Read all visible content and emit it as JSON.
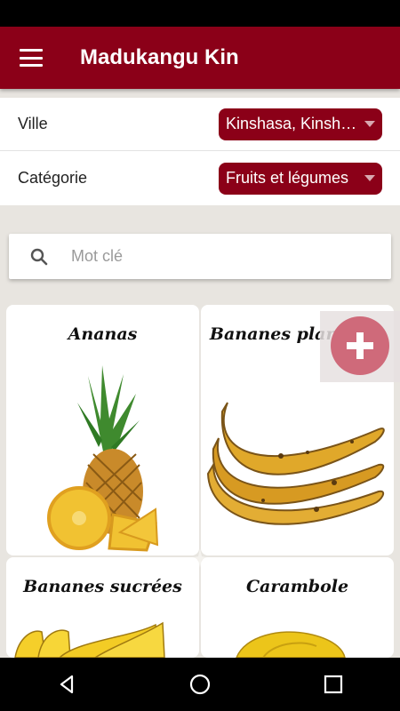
{
  "app": {
    "title": "Madukangu Kin"
  },
  "filters": {
    "city": {
      "label": "Ville",
      "value": "Kinshasa, Kinshasa"
    },
    "category": {
      "label": "Catégorie",
      "value": "Fruits et légumes"
    }
  },
  "search": {
    "placeholder": "Mot clé",
    "value": ""
  },
  "products": [
    {
      "name": "Ananas"
    },
    {
      "name": "Bananes plantains"
    },
    {
      "name": "Bananes sucrées"
    },
    {
      "name": "Carambole"
    }
  ],
  "colors": {
    "primary": "#8b0018",
    "fab": "#cf6a7a",
    "background": "#e8e5e0"
  },
  "icons": {
    "menu": "hamburger-icon",
    "search": "search-icon",
    "fab": "plus-icon",
    "nav": [
      "back-icon",
      "home-icon",
      "recents-icon"
    ]
  }
}
